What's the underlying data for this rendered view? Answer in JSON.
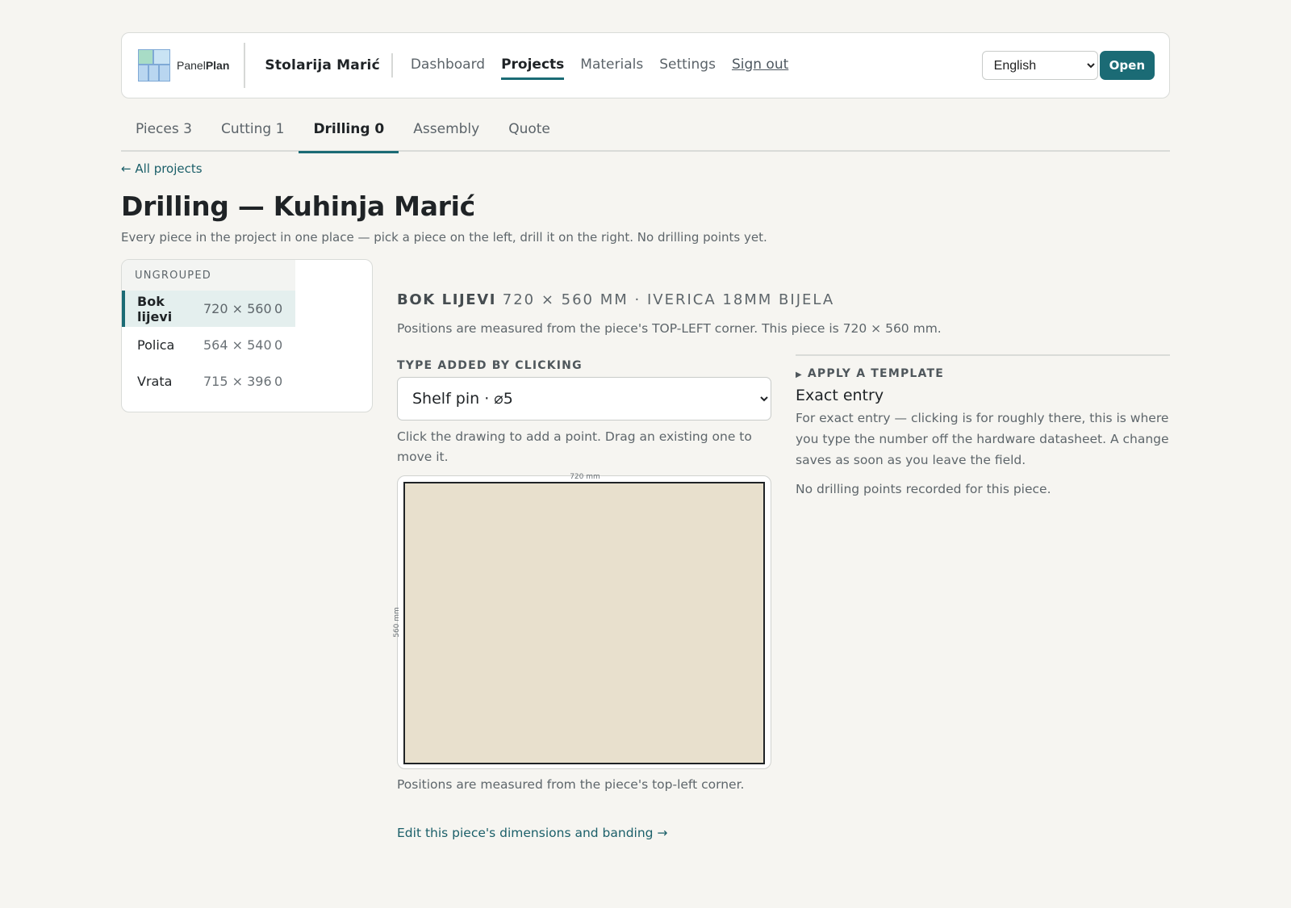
{
  "brand": {
    "name_light": "Panel",
    "name_bold": "Plan"
  },
  "shop_name": "Stolarija Marić",
  "nav": {
    "dashboard": "Dashboard",
    "projects": "Projects",
    "materials": "Materials",
    "settings": "Settings",
    "sign_out": "Sign out"
  },
  "language": {
    "selected": "English"
  },
  "open_label": "Open",
  "tabs": [
    {
      "label": "Pieces 3"
    },
    {
      "label": "Cutting 1"
    },
    {
      "label": "Drilling 0"
    },
    {
      "label": "Assembly"
    },
    {
      "label": "Quote"
    }
  ],
  "back_link": "← All projects",
  "page_title": "Drilling — Kuhinja Marić",
  "intro": "Every piece in the project in one place — pick a piece on the left, drill it on the right. No drilling points yet.",
  "pieces": {
    "group_label": "UNGROUPED",
    "items": [
      {
        "name": "Bok lijevi",
        "dims": "720 × 560",
        "count": "0"
      },
      {
        "name": "Polica",
        "dims": "564 × 540",
        "count": "0"
      },
      {
        "name": "Vrata",
        "dims": "715 × 396",
        "count": "0"
      }
    ]
  },
  "detail": {
    "piece_name": "BOK LIJEVI",
    "piece_meta": "720 × 560 MM · IVERICA 18MM BIJELA",
    "origin_note": "Positions are measured from the piece's TOP-LEFT corner. This piece is 720 × 560 mm.",
    "type_label": "TYPE ADDED BY CLICKING",
    "type_selected": "Shelf pin · ⌀5",
    "click_hint": "Click the drawing to add a point. Drag an existing one to move it.",
    "width_label": "720 mm",
    "height_label": "560 mm",
    "canvas_note": "Positions are measured from the piece's top-left corner.",
    "edit_link": "Edit this piece's dimensions and banding →",
    "template_label": "APPLY A TEMPLATE",
    "exact_title": "Exact entry",
    "exact_desc": "For exact entry — clicking is for roughly there, this is where you type the number off the hardware datasheet. A change saves as soon as you leave the field.",
    "empty_note": "No drilling points recorded for this piece."
  },
  "colors": {
    "accent": "#1b6b75",
    "board": "#e8e0cd",
    "background": "#f6f5f1"
  }
}
